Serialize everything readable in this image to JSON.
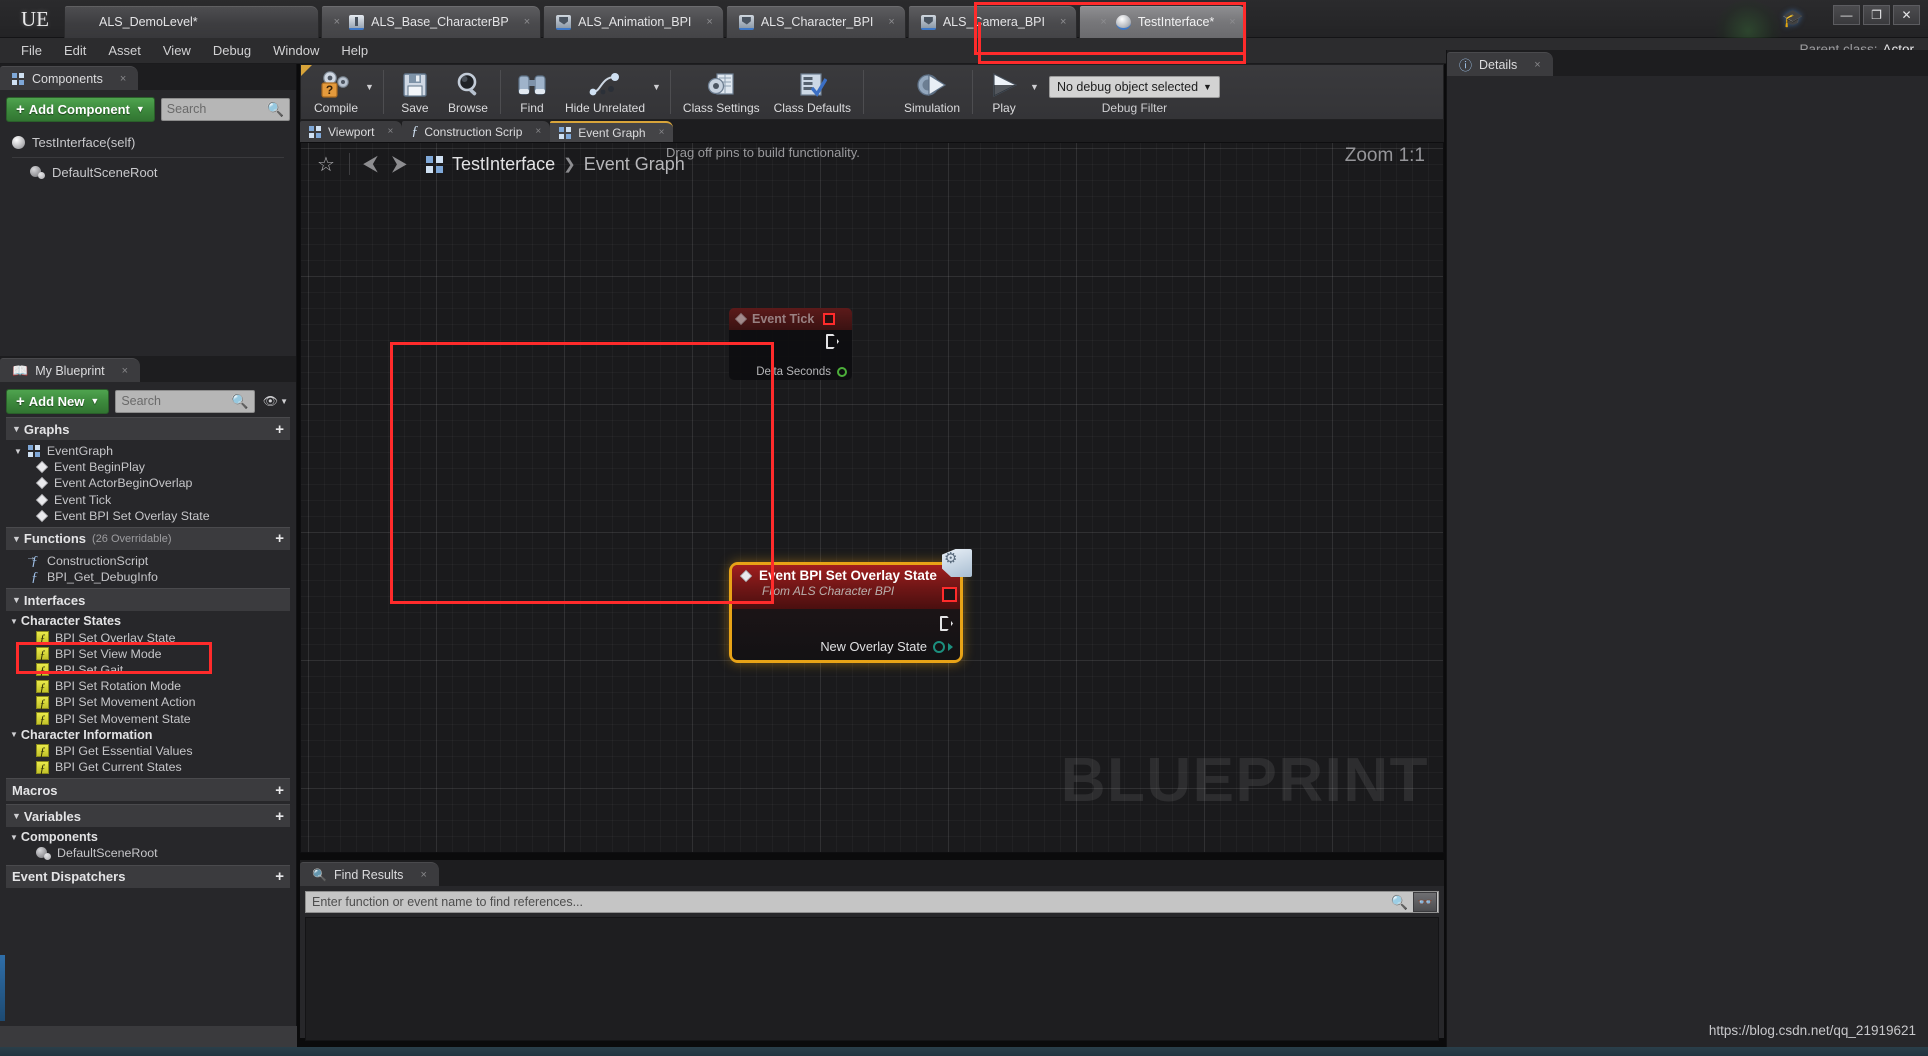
{
  "window": {
    "logo": "UE",
    "parent_class_label": "Parent class:",
    "parent_class_value": "Actor",
    "minimize": "—",
    "restore": "❐",
    "close": "✕"
  },
  "asset_tabs": [
    {
      "label": "ALS_DemoLevel*",
      "icon": "level-icon",
      "type": "level",
      "active": false,
      "close": "×"
    },
    {
      "label": "ALS_Base_CharacterBP",
      "icon": "blueprint-icon",
      "type": "actor",
      "active": false,
      "close": "×"
    },
    {
      "label": "ALS_Animation_BPI",
      "icon": "blueprint-icon",
      "type": "bp",
      "active": false,
      "close": "×"
    },
    {
      "label": "ALS_Character_BPI",
      "icon": "blueprint-icon",
      "type": "bp",
      "active": false,
      "close": "×"
    },
    {
      "label": "ALS_Camera_BPI",
      "icon": "blueprint-icon",
      "type": "bp",
      "active": false,
      "close": "×"
    },
    {
      "label": "TestInterface*",
      "icon": "object-icon",
      "type": "obj",
      "active": true,
      "close": "×"
    }
  ],
  "menu": [
    "File",
    "Edit",
    "Asset",
    "View",
    "Debug",
    "Window",
    "Help"
  ],
  "toolbar": {
    "buttons": [
      {
        "label": "Compile",
        "icon": "compile-gear-question-icon",
        "has_caret": true
      },
      {
        "label": "Save",
        "icon": "floppy-disk-icon",
        "has_caret": false
      },
      {
        "label": "Browse",
        "icon": "magnifier-icon",
        "has_caret": false
      },
      {
        "label": "Find",
        "icon": "binoculars-icon",
        "has_caret": false
      },
      {
        "label": "Hide Unrelated",
        "icon": "node-graph-icon",
        "has_caret": true
      },
      {
        "label": "Class Settings",
        "icon": "gear-document-icon",
        "has_caret": false
      },
      {
        "label": "Class Defaults",
        "icon": "checklist-icon",
        "has_caret": false
      },
      {
        "label": "Simulation",
        "icon": "play-gear-icon",
        "has_caret": false
      },
      {
        "label": "Play",
        "icon": "play-icon",
        "has_caret": true
      }
    ],
    "debug_object": "No debug object selected",
    "debug_filter_label": "Debug Filter"
  },
  "components_panel": {
    "tab_title": "Components",
    "tab_icon": "components-icon",
    "tab_close": "×",
    "add_component_label": "Add Component",
    "search_placeholder": "Search",
    "search_icon": "search-icon",
    "tree": [
      {
        "label": "TestInterface(self)",
        "icon": "self-dot-icon",
        "indent": 0
      },
      {
        "label": "DefaultSceneRoot",
        "icon": "scene-root-icon",
        "indent": 1
      }
    ]
  },
  "my_blueprint": {
    "tab_title": "My Blueprint",
    "tab_icon": "book-icon",
    "tab_close": "×",
    "add_new_label": "Add New",
    "search_placeholder": "Search",
    "search_icon": "search-icon",
    "eye_icon": "eye-icon",
    "sections": {
      "graphs": {
        "title": "Graphs",
        "add": "+"
      },
      "functions": {
        "title": "Functions",
        "sub": "(26 Overridable)",
        "add": "+"
      },
      "interfaces": {
        "title": "Interfaces"
      },
      "macros": {
        "title": "Macros",
        "add": "+"
      },
      "variables": {
        "title": "Variables",
        "add": "+"
      },
      "event_dispatchers": {
        "title": "Event Dispatchers",
        "add": "+"
      }
    },
    "graphs_tree": [
      {
        "label": "EventGraph",
        "icon": "graph-icon",
        "level": 1
      },
      {
        "label": "Event BeginPlay",
        "icon": "event-diamond-icon",
        "level": 2
      },
      {
        "label": "Event ActorBeginOverlap",
        "icon": "event-diamond-icon",
        "level": 2
      },
      {
        "label": "Event Tick",
        "icon": "event-diamond-icon",
        "level": 2
      },
      {
        "label": "Event BPI Set Overlay State",
        "icon": "event-diamond-icon",
        "level": 2
      }
    ],
    "functions_tree": [
      {
        "label": "ConstructionScript",
        "icon": "construction-script-icon",
        "level": 1
      },
      {
        "label": "BPI_Get_DebugInfo",
        "icon": "function-icon",
        "level": 1
      }
    ],
    "interface_groups": [
      {
        "group": "Character States",
        "items": [
          {
            "label": "BPI Set Overlay State",
            "icon": "interface-function-icon",
            "highlighted": true
          },
          {
            "label": "BPI Set View Mode",
            "icon": "interface-function-icon",
            "highlighted": false
          },
          {
            "label": "BPI Set Gait",
            "icon": "interface-function-icon",
            "highlighted": false
          },
          {
            "label": "BPI Set Rotation Mode",
            "icon": "interface-function-icon",
            "highlighted": false
          },
          {
            "label": "BPI Set Movement Action",
            "icon": "interface-function-icon",
            "highlighted": false
          },
          {
            "label": "BPI Set Movement State",
            "icon": "interface-function-icon",
            "highlighted": false
          }
        ]
      },
      {
        "group": "Character Information",
        "items": [
          {
            "label": "BPI Get Essential Values",
            "icon": "interface-function-icon",
            "highlighted": false
          },
          {
            "label": "BPI Get Current States",
            "icon": "interface-function-icon",
            "highlighted": false
          }
        ]
      }
    ],
    "components_tree": [
      {
        "label": "DefaultSceneRoot",
        "icon": "scene-root-icon"
      }
    ]
  },
  "graph": {
    "doc_tabs": [
      {
        "label": "Viewport",
        "icon": "viewport-icon",
        "active": false,
        "close": "×"
      },
      {
        "label": "Construction Scrip",
        "icon": "function-icon",
        "active": false,
        "close": "×"
      },
      {
        "label": "Event Graph",
        "icon": "graph-icon",
        "active": true,
        "close": "×"
      }
    ],
    "favorite_icon": "star-icon",
    "back_icon": "arrow-left-icon",
    "forward_icon": "arrow-right-icon",
    "breadcrumb_root": "TestInterface",
    "breadcrumb_leaf": "Event Graph",
    "breadcrumb_sep": "❯",
    "tip": "Drag off pins to build functionality.",
    "zoom": "Zoom 1:1",
    "watermark": "BLUEPRINT",
    "nodes": [
      {
        "title": "Event Tick",
        "subtitle": "",
        "pins": [
          {
            "label": "Delta Seconds",
            "color": "#4caf3a"
          }
        ],
        "occluded": true
      },
      {
        "title": "Event BPI Set Overlay State",
        "subtitle": "From ALS Character BPI",
        "pins": [
          {
            "label": "New Overlay State",
            "color": "#1c8f7e"
          }
        ],
        "selected": true
      }
    ]
  },
  "details_panel": {
    "tab_title": "Details",
    "tab_icon": "details-info-icon",
    "tab_close": "×"
  },
  "find_results": {
    "tab_title": "Find Results",
    "tab_icon": "magnifier-icon",
    "tab_close": "×",
    "input_placeholder": "Enter function or event name to find references...",
    "search_icon": "search-icon",
    "binoculars_icon": "binoculars-icon"
  },
  "watermark_url": "https://blog.csdn.net/qq_21919621",
  "colors": {
    "accent_orange": "#e8a317",
    "highlight_red": "#ff2b2b",
    "green_button": "#3d8a3d",
    "event_node_red": "#a11e1e",
    "exec_pin": "#e3e3e5",
    "enum_pin": "#1c8f7e"
  }
}
